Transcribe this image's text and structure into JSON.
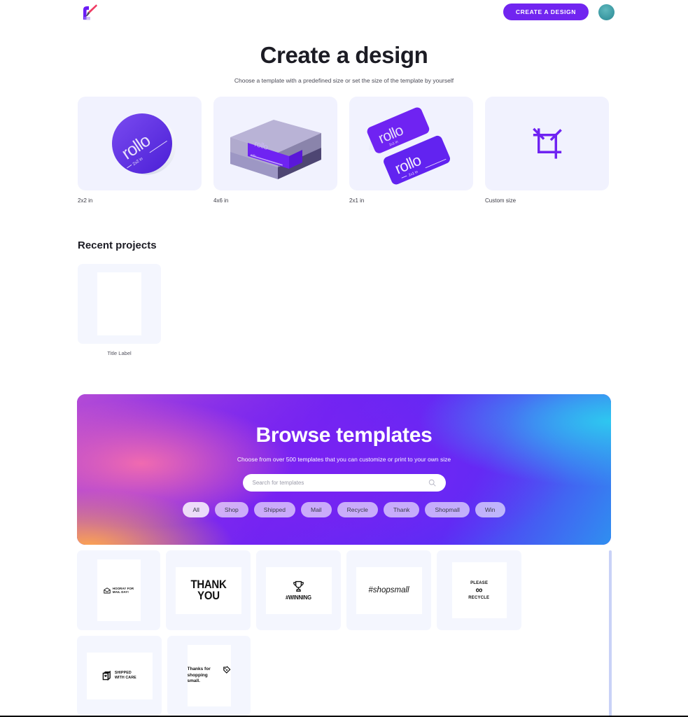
{
  "topbar": {
    "logo_name": "rollo-brush-logo",
    "cta_label": "CREATE A DESIGN",
    "avatar_name": "user-avatar"
  },
  "hero": {
    "title": "Create a design",
    "subtitle": "Choose a template with a predefined size or set the size of the template by yourself"
  },
  "sizes": [
    {
      "label": "2x2 in",
      "art": "round-sticker",
      "brand": "rollo",
      "size_text": "2x2 in"
    },
    {
      "label": "4x6 in",
      "art": "shipping-box",
      "brand": "rollo",
      "size_text": "4x6 in"
    },
    {
      "label": "2x1 in",
      "art": "rect-labels",
      "brand": "rollo",
      "size_text": "2x1 in"
    },
    {
      "label": "Custom size",
      "art": "crop-icon",
      "brand": "",
      "size_text": ""
    }
  ],
  "recent": {
    "heading": "Recent projects",
    "items": [
      {
        "label": "Title Label"
      }
    ]
  },
  "banner": {
    "title": "Browse templates",
    "subtitle": "Choose from over 500 templates that you can customize or print to your own size",
    "search_placeholder": "Search for templates",
    "search_value": "",
    "search_icon": "search-icon",
    "chips": [
      {
        "label": "All",
        "active": true
      },
      {
        "label": "Shop",
        "active": false
      },
      {
        "label": "Shipped",
        "active": false
      },
      {
        "label": "Mail",
        "active": false
      },
      {
        "label": "Recycle",
        "active": false
      },
      {
        "label": "Thank",
        "active": false
      },
      {
        "label": "Shopmall",
        "active": false
      },
      {
        "label": "Win",
        "active": false
      }
    ]
  },
  "templates": [
    {
      "id": "mail-day",
      "line1": "HOORAY FOR",
      "line2": "MAIL DAY!",
      "icon": "open-envelope-icon"
    },
    {
      "id": "thank-you",
      "line1": "THANK",
      "line2": "YOU",
      "icon": ""
    },
    {
      "id": "winning",
      "line1": "#WINNING",
      "line2": "",
      "icon": "trophy-icon"
    },
    {
      "id": "shopsmall",
      "line1": "#shopsmall",
      "line2": "",
      "icon": ""
    },
    {
      "id": "recycle",
      "line1": "PLEASE",
      "line2": "RECYCLE",
      "icon": "infinity-icon"
    },
    {
      "id": "shipped-care",
      "line1": "SHIPPED",
      "line2": "WITH CARE",
      "icon": "package-heart-icon"
    },
    {
      "id": "thanks-small",
      "line1": "Thanks for",
      "line2": "shopping small.",
      "icon": "price-tag-heart-icon"
    }
  ],
  "colors": {
    "accent_purple": "#7125f0",
    "card_bg": "#f1f2fe",
    "tile_bg": "#f4f6fe",
    "avatar_teal": "#3e9ba4",
    "scrollbar": "#c9d2f7"
  }
}
